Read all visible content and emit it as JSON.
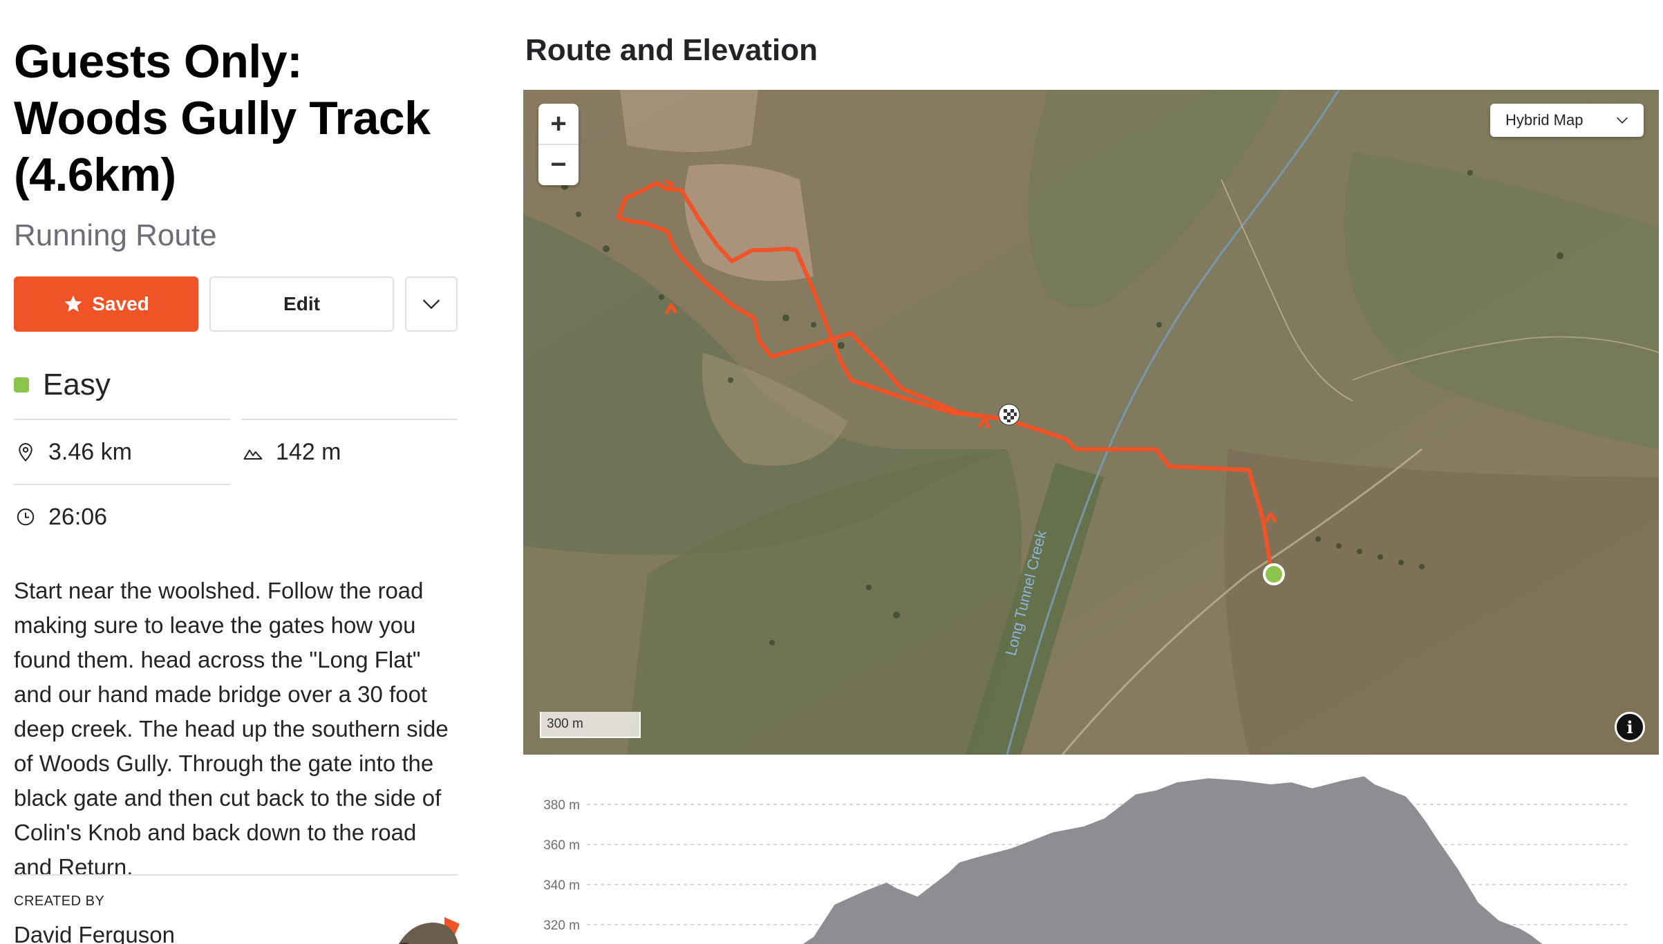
{
  "route": {
    "title": "Guests Only: Woods Gully Track (4.6km)",
    "type": "Running Route",
    "difficulty": "Easy",
    "difficulty_color": "#8cc34a",
    "description": "Start near the woolshed. Follow the road making sure to leave the gates how you found them. head across the \"Long Flat\" and our hand made bridge over a 30 foot deep creek. The head up the southern side of Woods Gully. Through the gate into the black gate and then cut back to the side of Colin's Knob and back down to the road and Return."
  },
  "actions": {
    "saved_label": "Saved",
    "edit_label": "Edit",
    "accent_color": "#f05326"
  },
  "stats": {
    "distance": "3.46 km",
    "elevation_gain": "142 m",
    "time": "26:06"
  },
  "creator": {
    "label": "CREATED BY",
    "name": "David Ferguson"
  },
  "map": {
    "section_title": "Route and Elevation",
    "map_type": "Hybrid Map",
    "scale_label": "300 m",
    "zoom_in": "+",
    "zoom_out": "−",
    "creek_label": "Long Tunnel Creek",
    "route_color": "#f05326",
    "start_color": "#8cc34a"
  },
  "chart_data": {
    "type": "area",
    "title": "",
    "xlabel": "",
    "ylabel": "",
    "y_ticks": [
      "380 m",
      "360 m",
      "340 m",
      "320 m"
    ],
    "y_tick_values": [
      380,
      360,
      340,
      320
    ],
    "ylim": [
      290,
      396
    ],
    "x": [
      0.0,
      0.17,
      0.18,
      0.2,
      0.22,
      0.24,
      0.27,
      0.29,
      0.3,
      0.32,
      0.33,
      0.35,
      0.36,
      0.38,
      0.41,
      0.43,
      0.45,
      0.48,
      0.5,
      0.51,
      0.52,
      0.53,
      0.55,
      0.57,
      0.6,
      0.63,
      0.66,
      0.68,
      0.7,
      0.73,
      0.75,
      0.76,
      0.77,
      0.79,
      0.8,
      0.81,
      0.82,
      0.84,
      0.86,
      0.88,
      0.9,
      0.91,
      0.92,
      0.93,
      0.94,
      0.96,
      1.0
    ],
    "y": [
      290,
      290,
      292,
      300,
      314,
      330,
      337,
      341,
      338,
      334,
      338,
      346,
      351,
      354,
      358,
      362,
      366,
      369,
      373,
      377,
      381,
      385,
      387,
      391,
      393,
      392,
      390,
      391,
      388,
      392,
      394,
      390,
      388,
      384,
      378,
      371,
      363,
      348,
      331,
      322,
      318,
      315,
      311,
      307,
      305,
      300,
      290
    ],
    "series_color": "#8e8e92"
  }
}
